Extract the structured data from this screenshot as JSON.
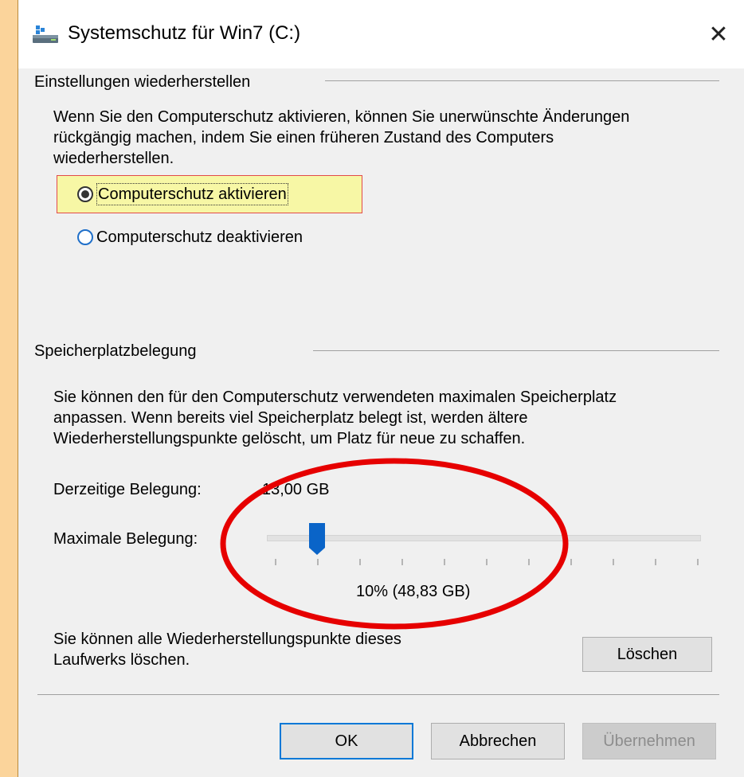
{
  "window": {
    "title": "Systemschutz für Win7 (C:)",
    "close_glyph": "✕"
  },
  "restore_section": {
    "heading": "Einstellungen wiederherstellen",
    "description_lines": [
      "Wenn Sie den Computerschutz aktivieren, können Sie unerwünschte Änderungen",
      "rückgängig machen, indem Sie einen früheren Zustand des Computers",
      "wiederherstellen."
    ],
    "option_enable": "Computerschutz aktivieren",
    "option_disable": "Computerschutz deaktivieren",
    "selected_option": "enable"
  },
  "disk_section": {
    "heading": "Speicherplatzbelegung",
    "description_lines": [
      "Sie können den für den Computerschutz verwendeten maximalen Speicherplatz",
      "anpassen. Wenn bereits viel Speicherplatz belegt ist, werden ältere",
      "Wiederherstellungspunkte gelöscht, um Platz für neue zu schaffen."
    ],
    "current_usage_label": "Derzeitige Belegung:",
    "current_usage_value": "13,00 GB",
    "max_usage_label": "Maximale Belegung:",
    "slider_value_percent": 10,
    "slider_readout": "10% (48,83 GB)",
    "delete_text_lines": [
      "Sie können alle Wiederherstellungspunkte dieses",
      "Laufwerks löschen."
    ],
    "delete_button": "Löschen"
  },
  "footer": {
    "ok_label": "OK",
    "cancel_label": "Abbrechen",
    "apply_label": "Übernehmen"
  },
  "colors": {
    "highlight_fill": "#f7f7a5",
    "highlight_border": "#e24a4a",
    "annotation_ellipse": "#e60000",
    "slider_thumb": "#0a64c8",
    "background": "#fbd49b"
  },
  "icons": {
    "title_icon": "drive-icon",
    "close_icon": "close-icon"
  }
}
